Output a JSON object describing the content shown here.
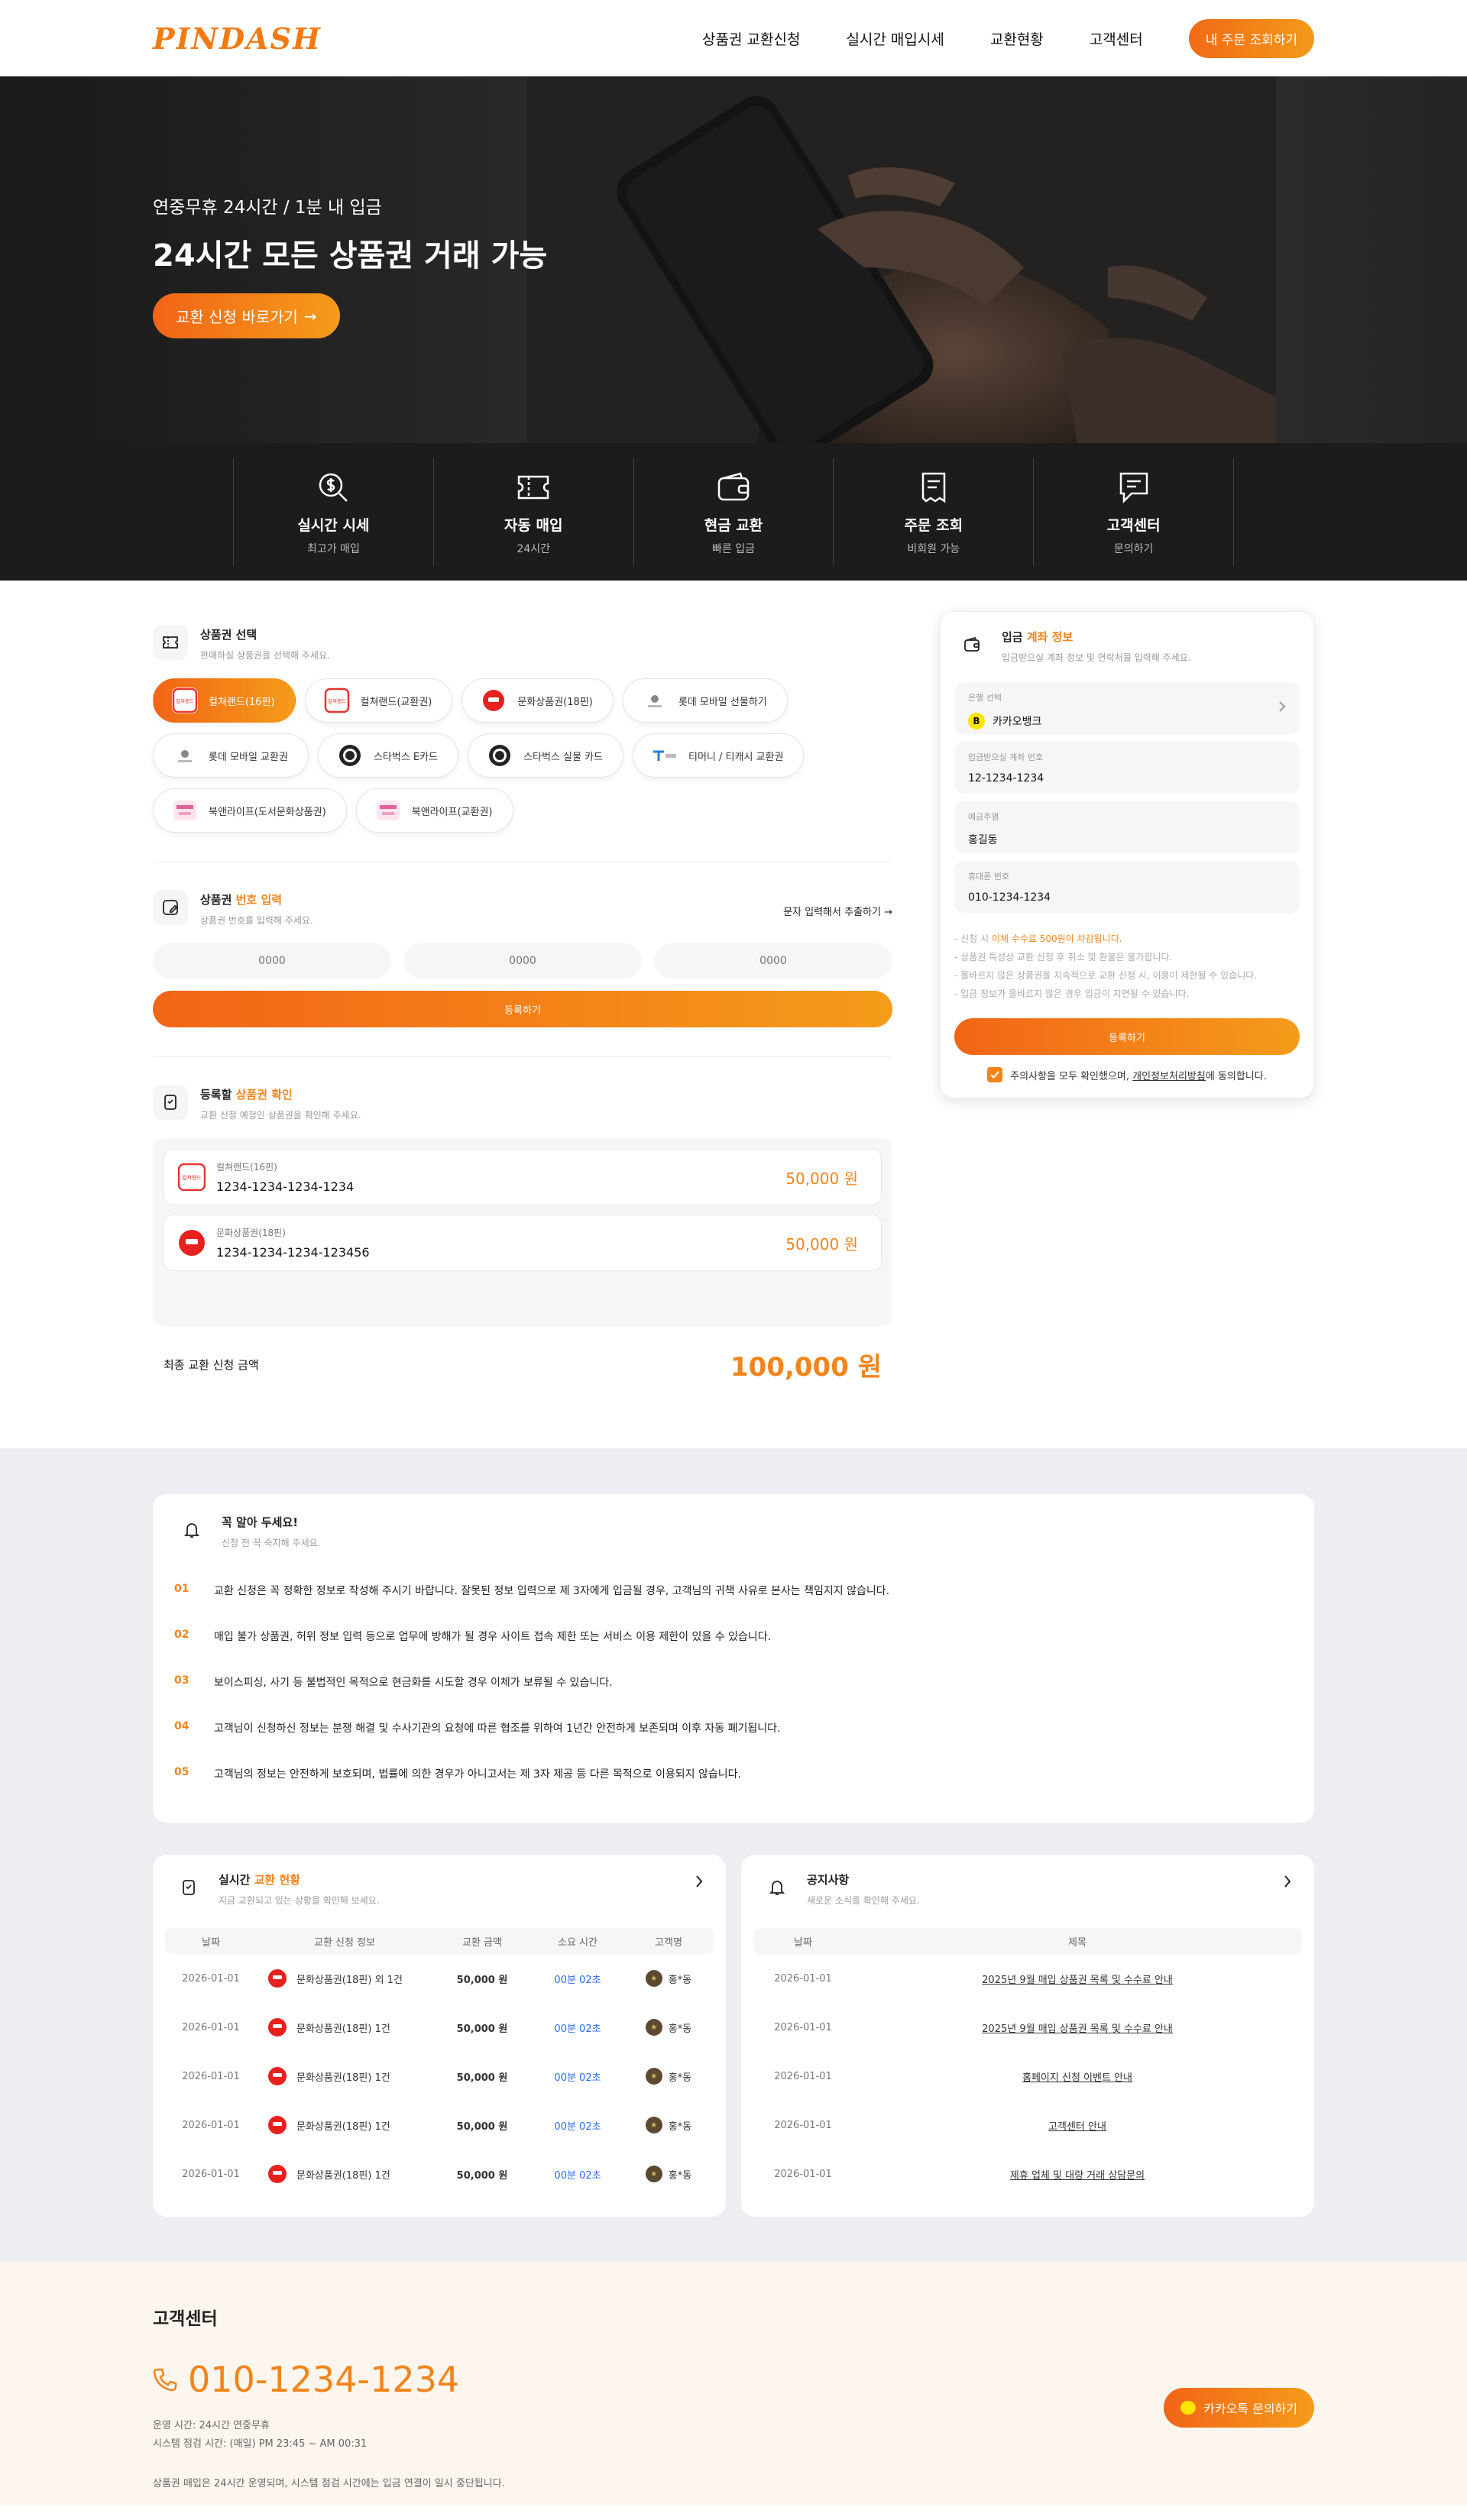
{
  "header": {
    "logo": "PINDASH",
    "nav": [
      "상품권 교환신청",
      "실시간 매입시세",
      "교환현황",
      "고객센터"
    ],
    "order_btn": "내 주문 조회하기"
  },
  "hero": {
    "sub": "연중무휴 24시간 / 1분 내 입금",
    "title": "24시간 모든 상품권 거래 가능",
    "btn": "교환 신청 바로가기"
  },
  "features": [
    {
      "title": "실시간 시세",
      "sub": "최고가 매입",
      "icon": "coin-search-icon"
    },
    {
      "title": "자동 매입",
      "sub": "24시간",
      "icon": "ticket-icon"
    },
    {
      "title": "현금 교환",
      "sub": "빠른 입금",
      "icon": "wallet-icon"
    },
    {
      "title": "주문 조회",
      "sub": "비회원 가능",
      "icon": "receipt-icon"
    },
    {
      "title": "고객센터",
      "sub": "문의하기",
      "icon": "chat-icon"
    }
  ],
  "select": {
    "title": "상품권 선택",
    "desc": "판매하실 상품권을 선택해 주세요.",
    "chips": [
      {
        "label": "컬쳐랜드(16핀)",
        "logo": "컬쳐랜드",
        "on": true
      },
      {
        "label": "컬쳐랜드(교환권)",
        "logo": "컬쳐랜드",
        "on": false
      },
      {
        "label": "문화상품권(18핀)",
        "logo": "",
        "on": false
      },
      {
        "label": "롯데 모바일 선물하기",
        "logo": "",
        "on": false
      },
      {
        "label": "롯데 모바일 교환권",
        "logo": "",
        "on": false
      },
      {
        "label": "스타벅스 E카드",
        "logo": "",
        "on": false
      },
      {
        "label": "스타벅스 실물 카드",
        "logo": "",
        "on": false
      },
      {
        "label": "티머니 / 티캐시 교환권",
        "logo": "",
        "on": false
      },
      {
        "label": "북앤라이프(도서문화상품권)",
        "logo": "",
        "on": false
      },
      {
        "label": "북앤라이프(교환권)",
        "logo": "",
        "on": false
      }
    ]
  },
  "pin": {
    "title_a": "상품권 ",
    "title_b": "번호 입력",
    "desc": "상품권 번호를 입력해 주세요.",
    "link": "문자 입력해서 추출하기",
    "placeholder": "0000",
    "btn": "등록하기"
  },
  "confirm": {
    "title_a": "등록할 ",
    "title_b": "상품권 확인",
    "desc": "교환 신청 예정인 상품권을 확인해 주세요.",
    "items": [
      {
        "name": "컬쳐랜드(16핀)",
        "code": "1234-1234-1234-1234",
        "amount": "50,000 원",
        "logo": "컬쳐랜드"
      },
      {
        "name": "문화상품권(18핀)",
        "code": "1234-1234-1234-123456",
        "amount": "50,000 원",
        "logo": ""
      }
    ],
    "total_label": "최종 교환 신청 금액",
    "total": "100,000 원"
  },
  "deposit": {
    "title_a": "입금 ",
    "title_b": "계좌 정보",
    "desc": "입금받으실 계좌 정보 및 연락처를 입력해 주세요.",
    "bank_label": "은행 선택",
    "bank": "카카오뱅크",
    "acct_label": "입금받으실 계좌 번호",
    "acct": "12-1234-1234",
    "name_label": "예금주명",
    "name": "홍길동",
    "phone_label": "휴대폰 번호",
    "phone": "010-1234-1234",
    "note1_a": "- 신청 시 ",
    "note1_b": "이체 수수료 500원이 차감됩니다.",
    "note2": "- 상품권 특성상 교환 신청 후 취소 및 환불은 불가합니다.",
    "note3": "- 올바르지 않은 상품권을 지속적으로 교환 신청 시, 이용이 제한될 수 있습니다.",
    "note4": "- 입금 정보가 올바르지 않은 경우 입금이 지연될 수 있습니다.",
    "btn": "등록하기",
    "agree_a": "주의사항을 모두 확인했으며, ",
    "agree_link": "개인정보처리방침",
    "agree_b": "에 동의합니다."
  },
  "notice": {
    "title": "꼭 알아 두세요!",
    "desc": "신청 전 꼭 숙지해 주세요.",
    "items": [
      {
        "num": "01",
        "text": "교환 신청은 꼭 정확한 정보로 작성해 주시기 바랍니다. 잘못된 정보 입력으로 제 3자에게 입금될 경우, 고객님의 귀책 사유로 본사는 책임지지 않습니다."
      },
      {
        "num": "02",
        "text": "매입 불가 상품권, 허위 정보 입력 등으로 업무에 방해가 될 경우 사이트 접속 제한 또는 서비스 이용 제한이 있을 수 있습니다."
      },
      {
        "num": "03",
        "text": "보이스피싱, 사기 등 불법적인 목적으로 현금화를 시도할 경우 이체가 보류될 수 있습니다."
      },
      {
        "num": "04",
        "text": "고객님이 신청하신 정보는 분쟁 해결 및 수사기관의 요청에 따른 협조를 위하여 1년간 안전하게 보존되며 이후 자동 폐기됩니다."
      },
      {
        "num": "05",
        "text": "고객님의 정보는 안전하게 보호되며, 법률에 의한 경우가 아니고서는 제 3자 제공 등 다른 목적으로 이용되지 않습니다."
      }
    ]
  },
  "live": {
    "title_a": "실시간 ",
    "title_b": "교환 현황",
    "desc": "지금 교환되고 있는 상황을 확인해 보세요.",
    "cols": [
      "날짜",
      "교환 신청 정보",
      "교환 금액",
      "소요 시간",
      "고객명"
    ],
    "rows": [
      {
        "date": "2026-01-01",
        "info": "문화상품권(18핀) 외 1건",
        "amount": "50,000 원",
        "time": "00분 02초",
        "name": "홍*동"
      },
      {
        "date": "2026-01-01",
        "info": "문화상품권(18핀) 1건",
        "amount": "50,000 원",
        "time": "00분 02초",
        "name": "홍*동"
      },
      {
        "date": "2026-01-01",
        "info": "문화상품권(18핀) 1건",
        "amount": "50,000 원",
        "time": "00분 02초",
        "name": "홍*동"
      },
      {
        "date": "2026-01-01",
        "info": "문화상품권(18핀) 1건",
        "amount": "50,000 원",
        "time": "00분 02초",
        "name": "홍*동"
      },
      {
        "date": "2026-01-01",
        "info": "문화상품권(18핀) 1건",
        "amount": "50,000 원",
        "time": "00분 02초",
        "name": "홍*동"
      }
    ]
  },
  "board": {
    "title": "공지사항",
    "desc": "새로운 소식을 확인해 주세요.",
    "cols": [
      "날짜",
      "제목"
    ],
    "rows": [
      {
        "date": "2026-01-01",
        "title": "2025년 9월 매입 상품권 목록 및 수수료 안내"
      },
      {
        "date": "2026-01-01",
        "title": "2025년 9월 매입 상품권 목록 및 수수료 안내"
      },
      {
        "date": "2026-01-01",
        "title": "홈페이지 신청 이벤트 안내"
      },
      {
        "date": "2026-01-01",
        "title": "고객센터 안내"
      },
      {
        "date": "2026-01-01",
        "title": "제휴 업체 및 대량 거래 상담문의"
      }
    ]
  },
  "footer": {
    "title": "고객센터",
    "phone": "010-1234-1234",
    "hours": "운영 시간: 24시간 연중무휴",
    "maint": "시스템 점검 시간: (매일) PM 23:45 ~ AM 00:31",
    "note": "상품권 매입은 24시간 운영되며, 시스템 점검 시간에는 입금 연결이 일시 중단됩니다.",
    "kakao": "카카오톡 문의하기"
  },
  "colors": {
    "accent": "#f2841a",
    "accent_grad_a": "#f26416",
    "accent_grad_b": "#f59c1a"
  }
}
